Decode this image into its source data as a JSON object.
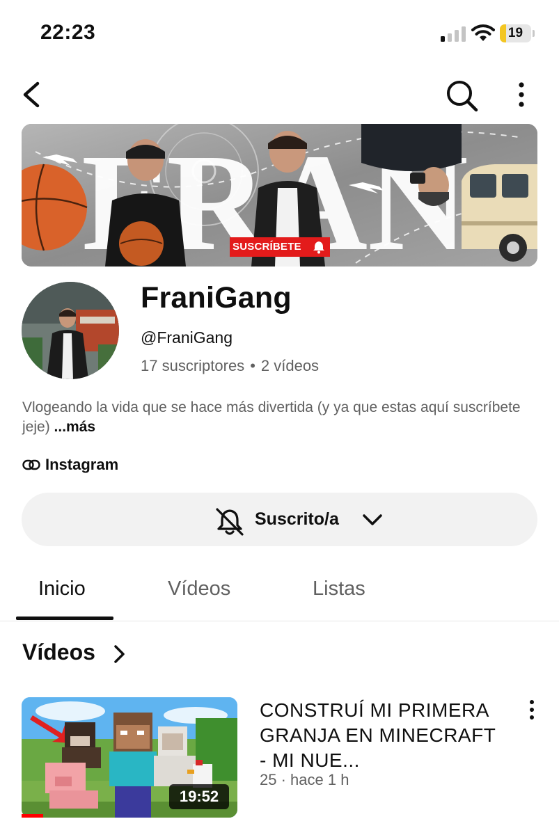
{
  "status_bar": {
    "time": "22:23",
    "battery_level": "19",
    "battery_fraction": 0.19,
    "signal_bars_active": 1,
    "signal_bars_total": 4,
    "battery_color": "#f3c623"
  },
  "header": {
    "back_icon": "chevron-left-icon",
    "search_icon": "search-icon",
    "more_icon": "more-vertical-icon"
  },
  "banner": {
    "title_text": "FRAN",
    "cta_label": "SUSCRÍBETE"
  },
  "channel": {
    "name": "FraniGang",
    "handle": "@FraniGang",
    "subscribers": "17 suscriptores",
    "separator": "•",
    "videos_count": "2 vídeos",
    "description": "Vlogeando la vida que se hace más divertida (y ya que estas aquí suscríbete jeje)",
    "more_label": "...más",
    "link_label": "Instagram"
  },
  "subscribe": {
    "label": "Suscrito/a"
  },
  "tabs": [
    {
      "label": "Inicio",
      "active": true
    },
    {
      "label": "Vídeos",
      "active": false
    },
    {
      "label": "Listas",
      "active": false
    }
  ],
  "section": {
    "title": "Vídeos"
  },
  "videos": [
    {
      "title": "CONSTRUÍ MI PRIMERA GRANJA EN MINECRAFT - MI NUE...",
      "meta": "25 · hace 1 h",
      "duration": "19:52",
      "watched_fraction": 0.1
    }
  ],
  "colors": {
    "accent": "#ff0000",
    "text_primary": "#0f0f0f",
    "text_secondary": "#606060",
    "button_bg": "#f2f2f2"
  }
}
